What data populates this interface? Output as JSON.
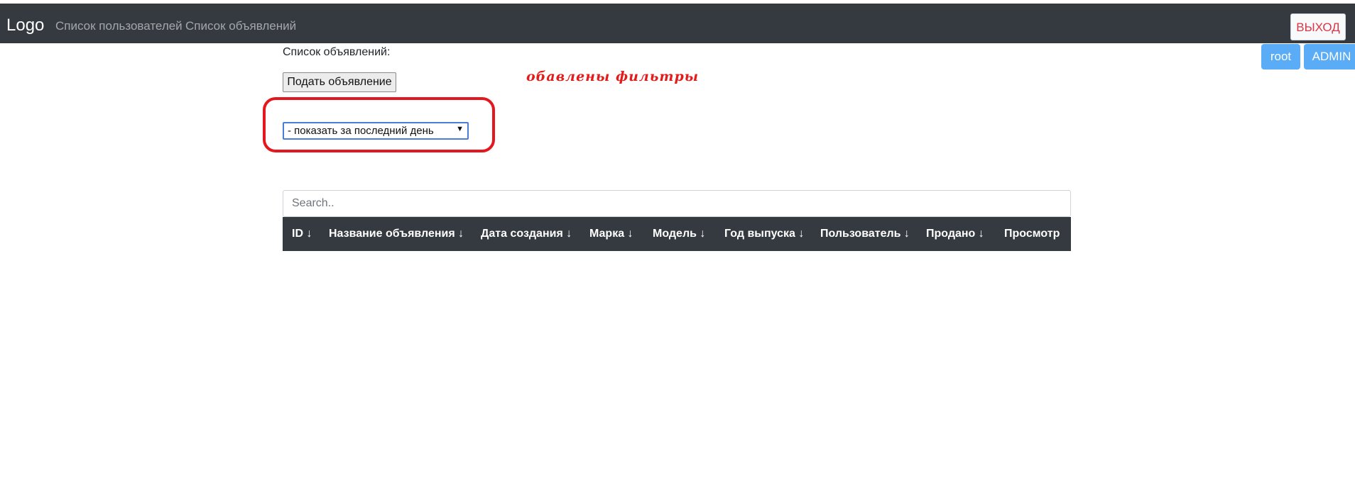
{
  "navbar": {
    "logo": "Logo",
    "links": [
      "Список пользователей",
      "Список объявлений"
    ],
    "logout_label": "ВЫХОД"
  },
  "user": {
    "name": "root",
    "role": "ADMIN"
  },
  "main": {
    "title": "Список объявлений:",
    "post_ad_label": "Подать объявление",
    "annotation": "обавлены фильтры",
    "filter": {
      "selected": "- показать за последний день"
    },
    "search": {
      "placeholder": "Search.."
    },
    "table": {
      "columns": [
        "ID ↓",
        "Название объявления ↓",
        "Дата создания ↓",
        "Марка ↓",
        "Модель ↓",
        "Год выпуска ↓",
        "Пользователь ↓",
        "Продано ↓",
        "Просмотр"
      ]
    }
  },
  "colors": {
    "navbar_bg": "#343a40",
    "badge_blue": "#5aacf6",
    "logout_text": "#dc3545",
    "annotation_red": "#e31b1b"
  }
}
